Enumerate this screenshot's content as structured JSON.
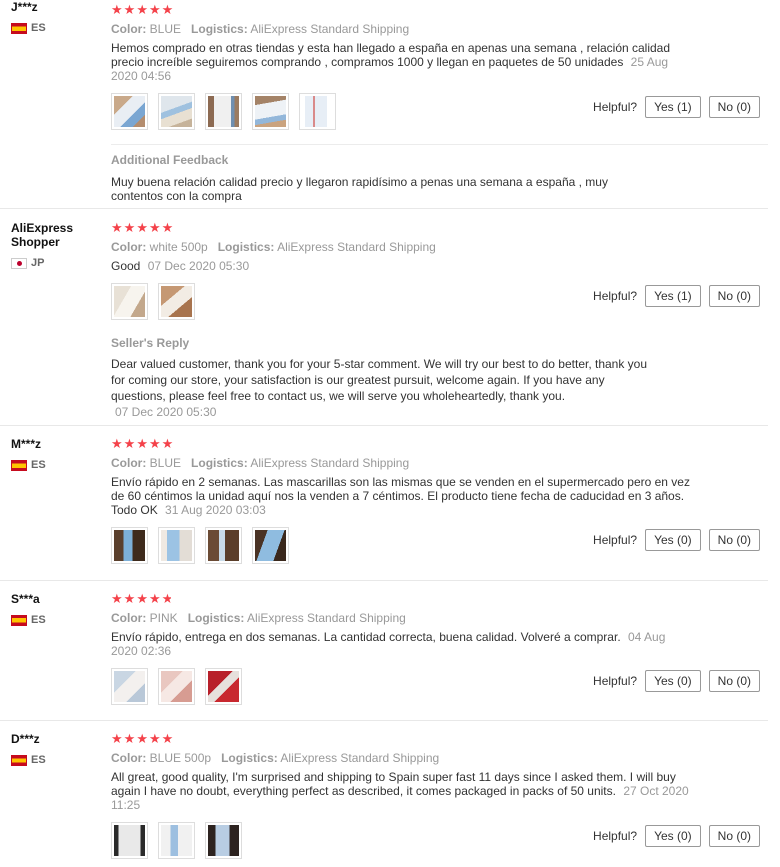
{
  "helpful_label": "Helpful?",
  "reviews": [
    {
      "user": "J***z",
      "country": "ES",
      "color_label": "Color:",
      "color_value": "BLUE",
      "logistics_label": "Logistics:",
      "logistics_value": "AliExpress Standard Shipping",
      "text": "Hemos comprado en otras tiendas y esta han llegado a españa en apenas una semana , relación calidad precio increíble seguiremos comprando , compramos 1000 y llegan en paquetes de 50 unidades",
      "date": "25 Aug 2020 04:56",
      "yes": "Yes (1)",
      "no": "No (0)",
      "extra_title": "Additional Feedback",
      "extra_text": "Muy buena relación calidad precio y llegaron rapidísimo a penas una semana a españa , muy contentos con la compra"
    },
    {
      "user": "AliExpress Shopper",
      "country": "JP",
      "color_label": "Color:",
      "color_value": "white 500p",
      "logistics_label": "Logistics:",
      "logistics_value": "AliExpress Standard Shipping",
      "text": "Good",
      "date": "07 Dec 2020 05:30",
      "yes": "Yes (1)",
      "no": "No (0)",
      "extra_title": "Seller's Reply",
      "extra_text": "Dear valued customer, thank you for your 5-star comment. We will try our best to do better, thank you for coming our store, your satisfaction is our greatest pursuit, welcome again. If you have any questions, please feel free to contact us, we will serve you wholeheartedly, thank you.",
      "extra_date": "07 Dec 2020 05:30"
    },
    {
      "user": "M***z",
      "country": "ES",
      "color_label": "Color:",
      "color_value": "BLUE",
      "logistics_label": "Logistics:",
      "logistics_value": "AliExpress Standard Shipping",
      "text": "Envío rápido en 2 semanas. Las mascarillas son las mismas que se venden en el supermercado pero en vez de 60 céntimos la unidad aquí nos la venden a 7 céntimos. El producto tiene fecha de caducidad en 3 años. Todo OK",
      "date": "31 Aug 2020 03:03",
      "yes": "Yes (0)",
      "no": "No (0)"
    },
    {
      "user": "S***a",
      "country": "ES",
      "color_label": "Color:",
      "color_value": "PINK",
      "logistics_label": "Logistics:",
      "logistics_value": "AliExpress Standard Shipping",
      "text": "Envío rápido, entrega en dos semanas. La cantidad correcta, buena calidad. Volveré a comprar.",
      "date": "04 Aug 2020 02:36",
      "yes": "Yes (0)",
      "no": "No (0)"
    },
    {
      "user": "D***z",
      "country": "ES",
      "color_label": "Color:",
      "color_value": "BLUE 500p",
      "logistics_label": "Logistics:",
      "logistics_value": "AliExpress Standard Shipping",
      "text": "All great, good quality, I'm surprised and shipping to Spain super fast 11 days since I asked them. I will buy again I have no doubt, everything perfect as described, it comes packaged in packs of 50 units.",
      "date": "27 Oct 2020 11:25",
      "yes": "Yes (0)",
      "no": "No (0)"
    }
  ],
  "star_color": "#f4424a"
}
